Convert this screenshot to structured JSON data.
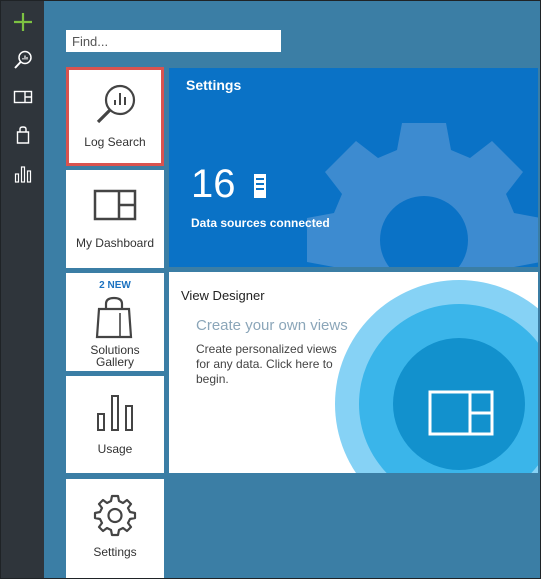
{
  "search": {
    "placeholder": "Find..."
  },
  "rail": {
    "items": [
      {
        "icon": "add-icon"
      },
      {
        "icon": "log-search-icon"
      },
      {
        "icon": "dashboard-icon"
      },
      {
        "icon": "solutions-bag-icon"
      },
      {
        "icon": "usage-chart-icon"
      }
    ]
  },
  "tiles": {
    "log_search": {
      "label": "Log Search",
      "selected": true
    },
    "my_dashboard": {
      "label": "My Dashboard"
    },
    "solutions_gallery": {
      "badge": "2 NEW",
      "label_line1": "Solutions",
      "label_line2": "Gallery"
    },
    "usage": {
      "label": "Usage"
    },
    "settings": {
      "label": "Settings"
    }
  },
  "settings_tile": {
    "title": "Settings",
    "count": "16",
    "count_label": "Data sources connected"
  },
  "view_designer": {
    "title": "View Designer",
    "subtitle": "Create your own views",
    "description": "Create personalized views for any data. Click here to begin."
  },
  "colors": {
    "background": "#3b7ea5",
    "rail": "#2f353b",
    "settings_blue": "#0a72c6",
    "selected_border": "#d9534f",
    "add_green": "#7dc242"
  }
}
